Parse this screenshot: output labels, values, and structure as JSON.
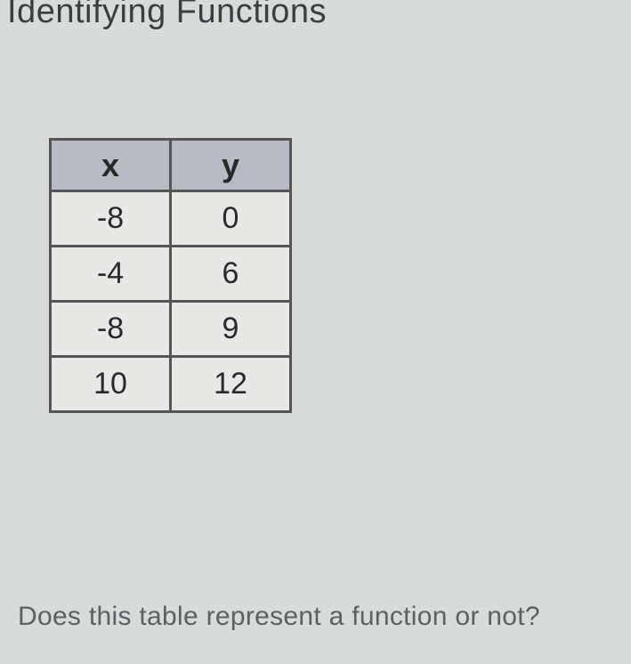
{
  "title": "Identifying Functions",
  "chart_data": {
    "type": "table",
    "columns": [
      "x",
      "y"
    ],
    "rows": [
      [
        "-8",
        "0"
      ],
      [
        "-4",
        "6"
      ],
      [
        "-8",
        "9"
      ],
      [
        "10",
        "12"
      ]
    ]
  },
  "question": "Does this table represent a function or not?"
}
